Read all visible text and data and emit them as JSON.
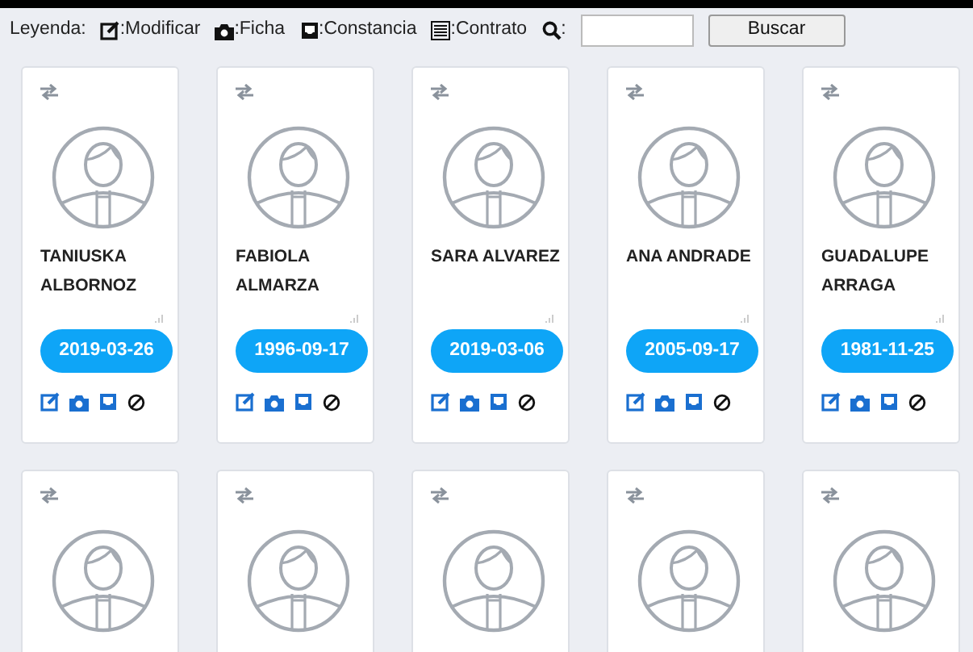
{
  "legend": {
    "label": "Leyenda:",
    "items": [
      {
        "kind": "edit",
        "label": ":Modificar"
      },
      {
        "kind": "camera",
        "label": ":Ficha"
      },
      {
        "kind": "tray",
        "label": ":Constancia"
      },
      {
        "kind": "list",
        "label": ":Contrato"
      }
    ],
    "search_label": ":",
    "button": "Buscar"
  },
  "cards": [
    {
      "kind": "full",
      "name": "TANIUSKA ALBORNOZ",
      "date": "2019-03-26"
    },
    {
      "kind": "full",
      "name": "FABIOLA ALMARZA",
      "date": "1996-09-17"
    },
    {
      "kind": "full",
      "name": "SARA ALVAREZ",
      "date": "2019-03-06"
    },
    {
      "kind": "full",
      "name": "ANA ANDRADE",
      "date": "2005-09-17"
    },
    {
      "kind": "full",
      "name": "GUADALUPE ARRAGA",
      "date": "1981-11-25"
    },
    {
      "kind": "partial"
    },
    {
      "kind": "partial"
    },
    {
      "kind": "partial"
    },
    {
      "kind": "partial"
    },
    {
      "kind": "partial"
    }
  ]
}
